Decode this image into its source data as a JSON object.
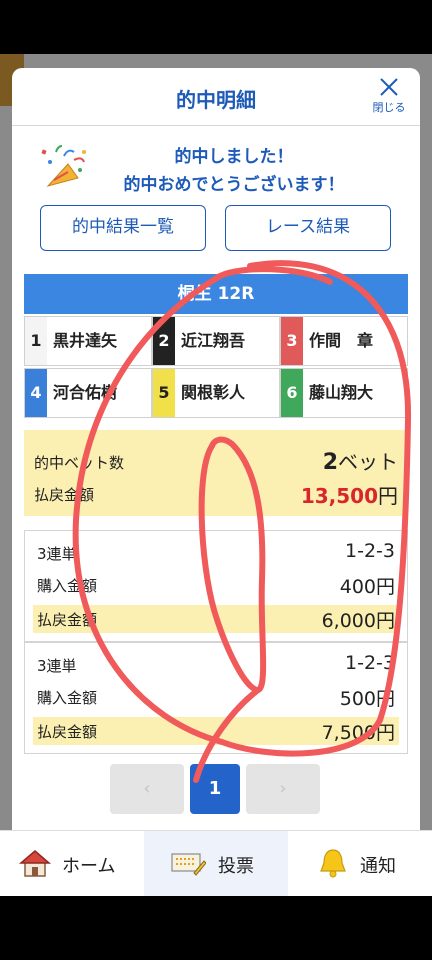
{
  "modal": {
    "title": "的中明細",
    "close_label": "閉じる",
    "congrats_line1": "的中しました！",
    "congrats_line2": "的中おめでとうございます！",
    "buttons": {
      "results_list": "的中結果一覧",
      "race_result": "レース結果"
    },
    "race_banner": "桐生 12R",
    "racers": [
      {
        "num": "1",
        "name": "黒井達矢"
      },
      {
        "num": "2",
        "name": "近江翔吾"
      },
      {
        "num": "3",
        "name": "作間　章"
      },
      {
        "num": "4",
        "name": "河合佑樹"
      },
      {
        "num": "5",
        "name": "関根彰人"
      },
      {
        "num": "6",
        "name": "藤山翔大"
      }
    ],
    "summary": {
      "bets_label": "的中ベット数",
      "bets_value": "2",
      "bets_unit": "ベット",
      "payout_label": "払戻金額",
      "payout_value": "13,500",
      "payout_unit": "円"
    },
    "bets": [
      {
        "type_label": "3連単",
        "combo": "1-2-3",
        "amount_label": "購入金額",
        "amount": "400円",
        "payout_label": "払戻金額",
        "payout": "6,000円"
      },
      {
        "type_label": "3連単",
        "combo": "1-2-3",
        "amount_label": "購入金額",
        "amount": "500円",
        "payout_label": "払戻金額",
        "payout": "7,500円"
      }
    ],
    "pagination": {
      "prev": "‹",
      "current": "1",
      "next": "›"
    }
  },
  "tabbar": {
    "home": "ホーム",
    "vote": "投票",
    "notice": "通知"
  },
  "colors": {
    "accent": "#1e5bb8",
    "banner": "#3a86e0",
    "highlight": "#fbf0b2",
    "payout_red": "#d8262c",
    "scribble": "#f05a5a"
  },
  "icons": [
    "close-icon",
    "party-popper-icon",
    "home-icon",
    "ticket-icon",
    "bell-icon"
  ]
}
